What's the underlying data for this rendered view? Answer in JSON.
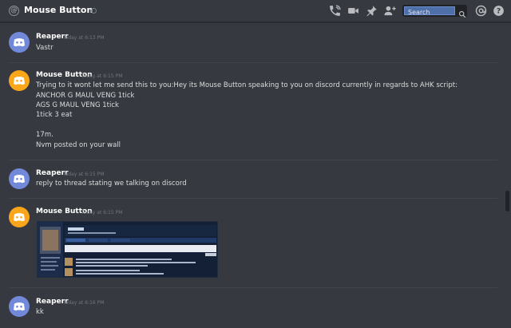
{
  "header": {
    "title": "Mouse Button",
    "search_placeholder": "Search",
    "icons": [
      "at-icon",
      "status-dot-icon",
      "call-icon",
      "video-icon",
      "pin-icon",
      "add-friend-icon",
      "search-icon",
      "mention-icon",
      "help-icon"
    ]
  },
  "messages": [
    {
      "author": "Reaperr",
      "timestamp": "Today at 6:13 PM",
      "lines": [
        "Vastr"
      ]
    },
    {
      "author": "Mouse Button",
      "timestamp": "Today at 6:15 PM",
      "lines": [
        "Trying to it wont let me send this to you:Hey its Mouse Button speaking to you on discord currently in regards to AHK script:",
        "ANCHOR G MAUL VENG 1tick",
        "AGS G MAUL VENG 1tick",
        "1tick 3 eat",
        "",
        "17m.",
        "Nvm posted on your wall"
      ]
    },
    {
      "author": "Reaperr",
      "timestamp": "Today at 6:15 PM",
      "lines": [
        "reply to thread stating we talking on discord"
      ]
    },
    {
      "author": "Mouse Button",
      "timestamp": "Today at 6:15 PM",
      "lines": []
    },
    {
      "author": "Reaperr",
      "timestamp": "Today at 6:16 PM",
      "lines": [
        "kk"
      ]
    }
  ],
  "colors": {
    "background": "#36393f",
    "avatar_blue": "#7289da",
    "avatar_orange": "#faa61a",
    "text": "#dcddde",
    "timestamp": "#72767d"
  }
}
